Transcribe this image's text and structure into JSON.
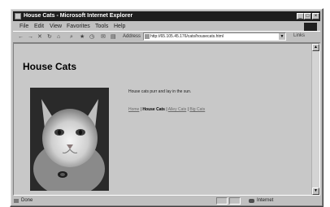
{
  "window": {
    "title": "House Cats - Microsoft Internet Explorer"
  },
  "menu": {
    "items": [
      "File",
      "Edit",
      "View",
      "Favorites",
      "Tools",
      "Help"
    ]
  },
  "toolbar": {
    "address_label": "Address",
    "url": "http://65.105.45.176/cats/housecats.html",
    "go_label": "Links"
  },
  "page": {
    "heading": "House Cats",
    "description": "House cats purr and lay in the sun.",
    "nav": {
      "home": "Home",
      "current": "House Cats",
      "link2": "Alley Cats",
      "link3": "Big Cats",
      "separator": " | "
    },
    "image_alt": "white long-haired cat"
  },
  "status": {
    "left": "Done",
    "zone": "Internet"
  }
}
